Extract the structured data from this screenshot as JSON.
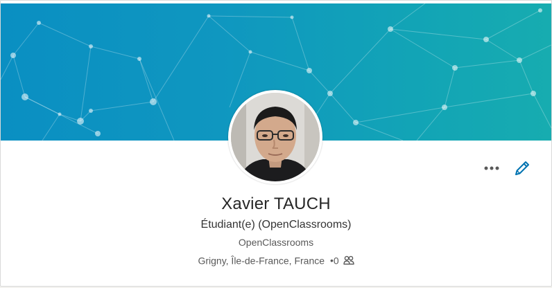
{
  "profile": {
    "name": "Xavier TAUCH",
    "headline": "Étudiant(e) (OpenClassrooms)",
    "company": "OpenClassrooms",
    "location": "Grigny, Île-de-France, France",
    "connections_separator": "•",
    "connections_count": "0"
  },
  "icons": {
    "more": "more-horizontal-icon",
    "edit": "pencil-icon",
    "connections": "people-icon"
  },
  "colors": {
    "banner_start": "#0a8fc2",
    "banner_end": "#17acb0",
    "edit_accent": "#0073b1",
    "text_primary": "#262626",
    "text_secondary": "#595959"
  }
}
